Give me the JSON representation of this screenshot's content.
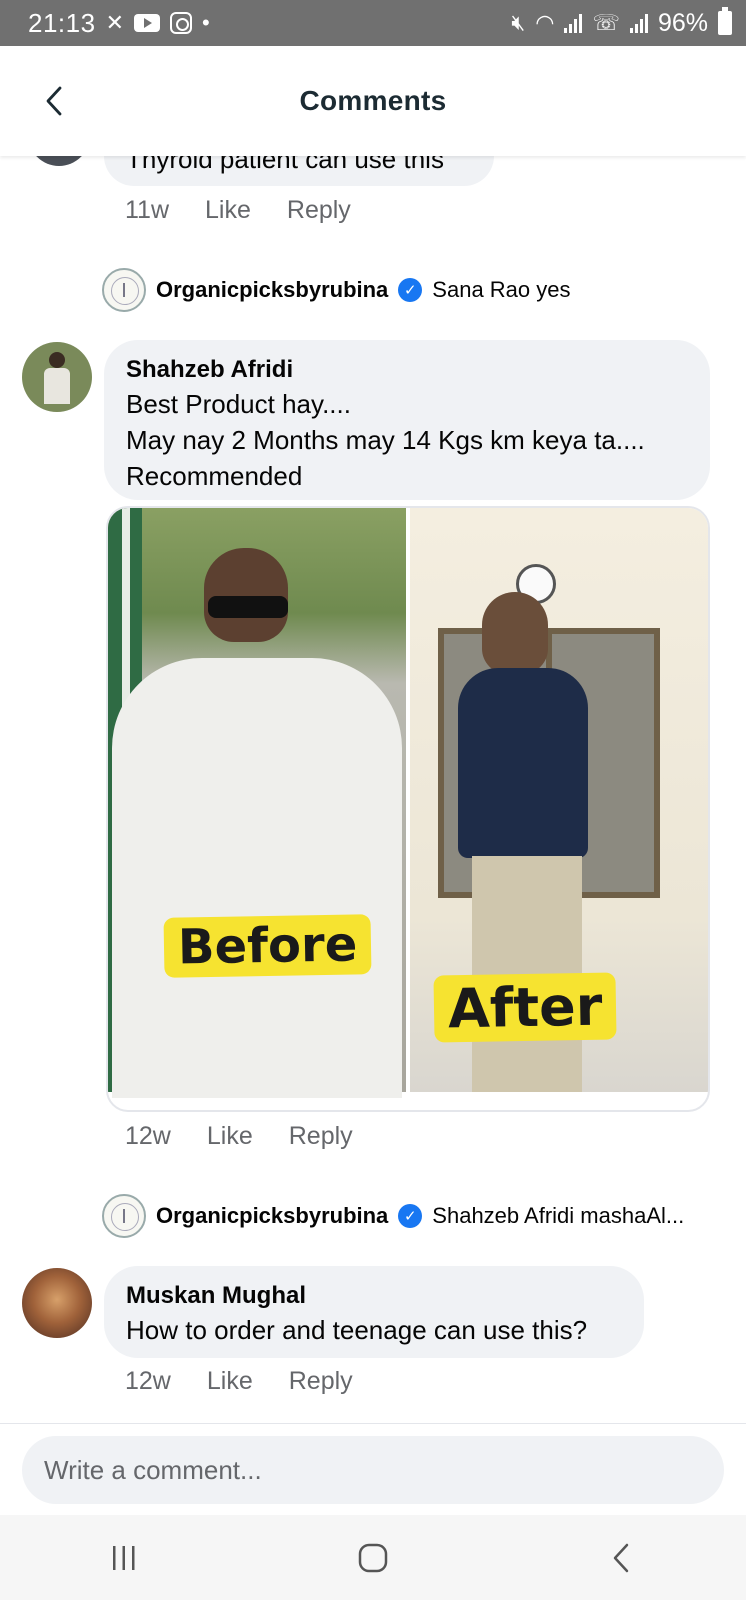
{
  "status_bar": {
    "time": "21:13",
    "battery": "96%"
  },
  "header": {
    "title": "Comments"
  },
  "comments": [
    {
      "text": "Thyroid patient can use this",
      "age": "11w",
      "like": "Like",
      "reply": "Reply",
      "reply_preview": {
        "author": "Organicpicksbyrubina",
        "text": "Sana Rao yes"
      }
    },
    {
      "author": "Shahzeb Afridi",
      "line1": "Best Product hay....",
      "line2": "May nay 2 Months may 14 Kgs km keya ta....",
      "line3": "Recommended",
      "image_labels": {
        "before": "Before",
        "after": "After"
      },
      "age": "12w",
      "like": "Like",
      "reply": "Reply",
      "reply_preview": {
        "author": "Organicpicksbyrubina",
        "text": "Shahzeb Afridi mashaAl..."
      }
    },
    {
      "author": "Muskan Mughal",
      "text": "How to order and teenage can use this?",
      "age": "12w",
      "like": "Like",
      "reply": "Reply"
    }
  ],
  "composer": {
    "placeholder": "Write a comment..."
  },
  "colors": {
    "status_bar": "#707070",
    "bubble": "#f0f2f5",
    "verified": "#1877f2",
    "label_highlight": "#f6e330"
  }
}
